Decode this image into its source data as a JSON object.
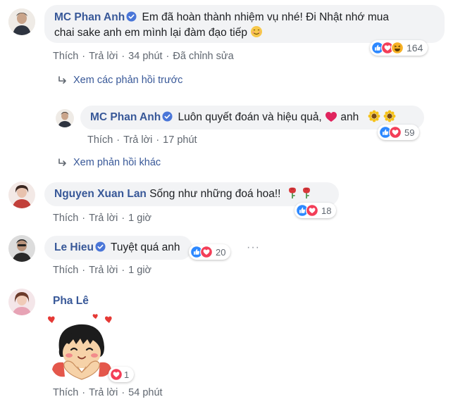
{
  "comments": [
    {
      "author": "MC Phan Anh",
      "line1": "Em đã hoàn thành nhiệm vụ nhé! Đi Nhật nhớ mua",
      "line2": "chai sake anh em mình lại đàm đạo tiếp",
      "like": "Thích",
      "reply": "Trả lời",
      "time": "34 phút",
      "edited": "Đã chỉnh sửa",
      "reactions_count": "164"
    },
    {
      "author": "MC Phan Anh",
      "text_before": "Luôn quyết đoán và hiệu quả,",
      "text_after": "anh",
      "like": "Thích",
      "reply": "Trả lời",
      "time": "17 phút",
      "reactions_count": "59"
    },
    {
      "author": "Nguyen Xuan Lan",
      "text": "Sống như những đoá hoa!!",
      "like": "Thích",
      "reply": "Trả lời",
      "time": "1 giờ",
      "reactions_count": "18"
    },
    {
      "author": "Le Hieu",
      "text": "Tuyệt quá anh",
      "like": "Thích",
      "reply": "Trả lời",
      "time": "1 giờ",
      "reactions_count": "20",
      "more": "···"
    },
    {
      "author": "Pha Lê",
      "like": "Thích",
      "reply": "Trả lời",
      "time": "54 phút",
      "reactions_count": "1"
    }
  ],
  "links": {
    "previous_replies": "Xem các phản hồi trước",
    "other_replies": "Xem phản hồi khác"
  },
  "colors": {
    "name": "#385898",
    "bubble": "#f2f3f5",
    "meta": "#606770",
    "like_blue": "#2d88ff",
    "love_red": "#f33e58",
    "haha_yellow": "#f7b125"
  }
}
